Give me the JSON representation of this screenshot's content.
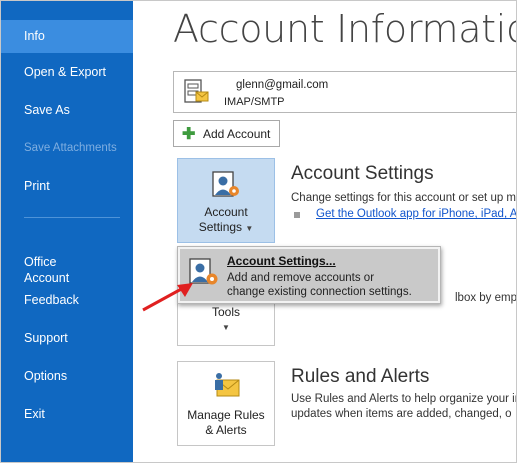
{
  "sidebar": {
    "items": [
      {
        "label": "Info",
        "active": true
      },
      {
        "label": "Open & Export"
      },
      {
        "label": "Save As"
      },
      {
        "label": "Save Attachments",
        "disabled": true
      },
      {
        "label": "Print"
      },
      {
        "label": "Office\nAccount"
      },
      {
        "label": "Feedback"
      },
      {
        "label": "Support"
      },
      {
        "label": "Options"
      },
      {
        "label": "Exit"
      }
    ],
    "color": "#1068c1",
    "active_color": "#3b8de0"
  },
  "main": {
    "title": "Account Information",
    "account": {
      "email": "glenn@gmail.com",
      "type": "IMAP/SMTP"
    },
    "add_account_label": "Add Account",
    "account_settings": {
      "button_line1": "Account",
      "button_line2": "Settings",
      "title": "Account Settings",
      "desc": "Change settings for this account or set up m",
      "link": "Get the Outlook app for iPhone, iPad, A"
    },
    "popup": {
      "title": "Account Settings...",
      "desc_line1": "Add and remove accounts or",
      "desc_line2": "change existing connection settings."
    },
    "tools": {
      "button_label": "Tools",
      "desc_fragment": "lbox by emptyi"
    },
    "rules": {
      "button_line1": "Manage Rules",
      "button_line2": "& Alerts",
      "title": "Rules and Alerts",
      "desc_line1": "Use Rules and Alerts to help organize your ir",
      "desc_line2": "updates when items are added, changed, o"
    }
  },
  "colors": {
    "annotation_arrow": "#e02020",
    "link": "#1155cc"
  }
}
